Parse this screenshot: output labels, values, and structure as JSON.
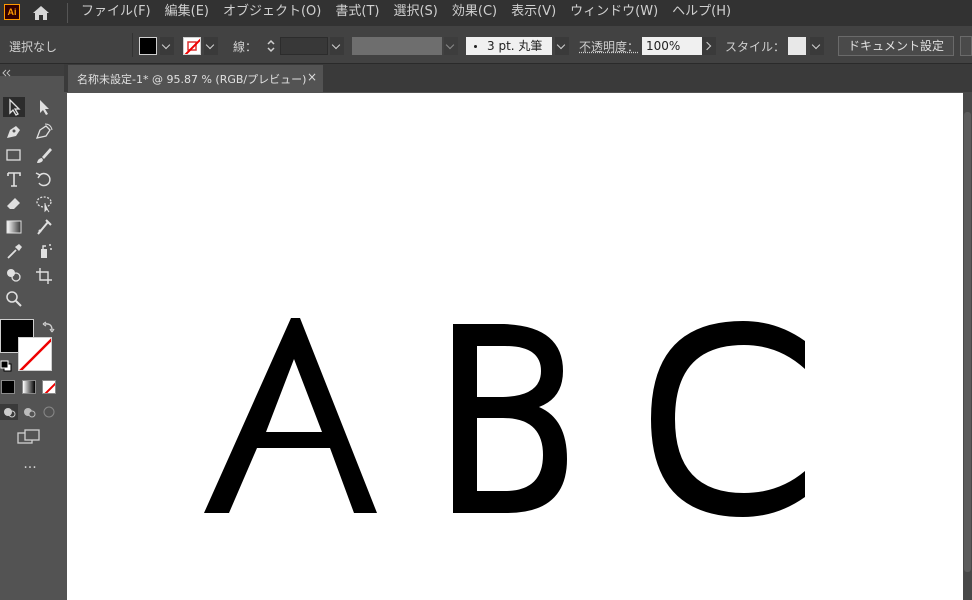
{
  "app": {
    "logo_text": "Ai"
  },
  "menu": [
    "ファイル(F)",
    "編集(E)",
    "オブジェクト(O)",
    "書式(T)",
    "選択(S)",
    "効果(C)",
    "表示(V)",
    "ウィンドウ(W)",
    "ヘルプ(H)"
  ],
  "control": {
    "selection_label": "選択なし",
    "stroke_label": "線：",
    "brush_value": "3 pt. 丸筆",
    "opacity_label": "不透明度：",
    "opacity_value": "100%",
    "style_label": "スタイル：",
    "document_setup_button": "ドキュメント設定"
  },
  "document": {
    "tab_title": "名称未設定-1* @ 95.87 % (RGB/プレビュー)",
    "close_symbol": "×"
  },
  "artboard": {
    "letters": [
      "A",
      "B",
      "C"
    ]
  },
  "toolbar": {
    "more_tools": "..."
  },
  "colors": {
    "fill": "#000000",
    "stroke": "none",
    "accent": "#ff9a00"
  }
}
